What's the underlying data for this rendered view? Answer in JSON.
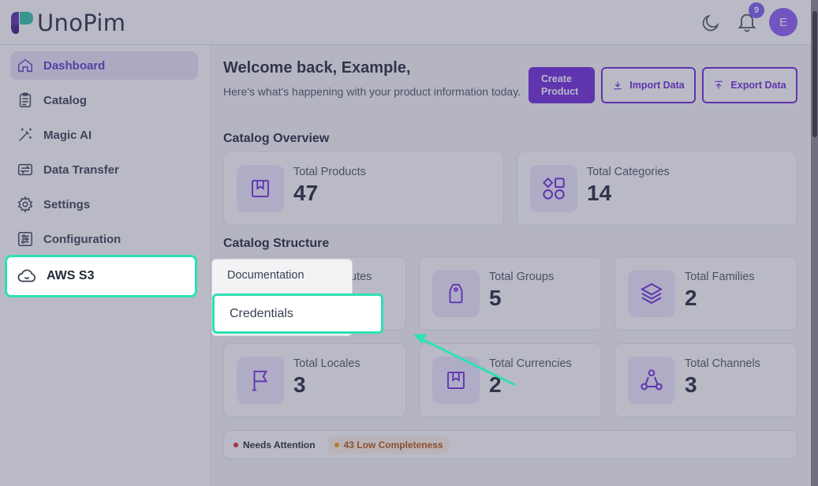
{
  "app": {
    "logo_text": "UnoPim",
    "notifications_count": "9",
    "avatar_initial": "E"
  },
  "sidebar": {
    "items": [
      {
        "label": "Dashboard",
        "icon": "home-icon",
        "active": true
      },
      {
        "label": "Catalog",
        "icon": "clipboard-icon"
      },
      {
        "label": "Magic AI",
        "icon": "magic-wand-icon"
      },
      {
        "label": "Data Transfer",
        "icon": "data-transfer-icon"
      },
      {
        "label": "Settings",
        "icon": "gear-icon"
      },
      {
        "label": "Configuration",
        "icon": "sliders-icon"
      },
      {
        "label": "AWS S3",
        "icon": "cloud-icon",
        "highlighted": true
      }
    ]
  },
  "submenu": {
    "documentation": "Documentation",
    "credentials": "Credentials"
  },
  "welcome": {
    "title": "Welcome back, Example,",
    "subtitle": "Here's what's happening with your product information today."
  },
  "actions": {
    "create": "Create Product",
    "import": "Import Data",
    "export": "Export Data"
  },
  "overview": {
    "title": "Catalog Overview",
    "cards": [
      {
        "label": "Total Products",
        "value": "47",
        "icon": "bookmark-box-icon"
      },
      {
        "label": "Total Categories",
        "value": "14",
        "icon": "shapes-icon"
      }
    ]
  },
  "structure": {
    "title": "Catalog Structure",
    "cards": [
      {
        "label": "Total Attributes",
        "value": "",
        "icon": "attribute-icon"
      },
      {
        "label": "Total Groups",
        "value": "5",
        "icon": "tag-icon"
      },
      {
        "label": "Total Families",
        "value": "2",
        "icon": "layers-icon"
      },
      {
        "label": "Total Locales",
        "value": "3",
        "icon": "flag-icon"
      },
      {
        "label": "Total Currencies",
        "value": "2",
        "icon": "bookmark-box-icon"
      },
      {
        "label": "Total Channels",
        "value": "3",
        "icon": "channels-icon"
      }
    ],
    "partial_attr_label": "utes"
  },
  "attention": {
    "needs": "Needs Attention",
    "low": "43 Low Completeness"
  },
  "colors": {
    "accent": "#6d28d9",
    "highlight": "#2ee0b4",
    "overlay": "#4a4a68"
  }
}
